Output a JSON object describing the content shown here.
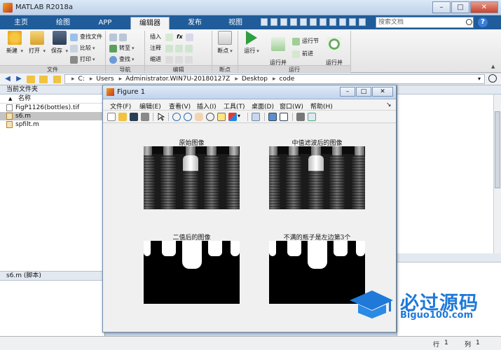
{
  "window": {
    "title": "MATLAB R2018a",
    "minimize": "–",
    "maximize": "□",
    "close": "✕"
  },
  "tabs": [
    {
      "label": "主页"
    },
    {
      "label": "绘图"
    },
    {
      "label": "APP"
    },
    {
      "label": "编辑器"
    },
    {
      "label": "发布"
    },
    {
      "label": "视图"
    }
  ],
  "search": {
    "placeholder": "搜索文档"
  },
  "help": "?",
  "ribbon": {
    "file": {
      "group": "文件",
      "new": "新建",
      "open": "打开",
      "save": "保存",
      "find_files": "查找文件",
      "compare": "比较",
      "print": "打印"
    },
    "navigate": {
      "group": "导航",
      "goto": "转至",
      "find": "查找"
    },
    "edit": {
      "group": "编辑",
      "insert": "插入",
      "comment": "注释",
      "indent": "缩进",
      "fx": "fx"
    },
    "breakpoints": {
      "group": "断点",
      "breakpoint": "断点"
    },
    "run": {
      "group": "运行",
      "run": "运行",
      "run_advance": "运行并\n前进",
      "run_section": "运行节",
      "advance": "前进",
      "run_time": "运行并\n计时"
    }
  },
  "address": {
    "crumbs": [
      "C:",
      "Users",
      "Administrator.WIN7U-20180127Z",
      "Desktop",
      "code"
    ]
  },
  "current_folder": {
    "title": "当前文件夹",
    "column_header": "名称",
    "sort_arrow": "▲",
    "files": [
      {
        "name": "FigP1126(bottles).tif",
        "type": "image",
        "selected": false
      },
      {
        "name": "s6.m",
        "type": "m",
        "selected": true
      },
      {
        "name": "spfilt.m",
        "type": "m",
        "selected": false
      }
    ],
    "details": "s6.m  (脚本)"
  },
  "figure": {
    "title": "Figure 1",
    "menus": [
      "文件(F)",
      "编辑(E)",
      "查看(V)",
      "插入(I)",
      "工具(T)",
      "桌面(D)",
      "窗口(W)",
      "帮助(H)"
    ],
    "dock_arrow": "↘",
    "subplots": [
      {
        "title": "原始图像",
        "kind": "gray"
      },
      {
        "title": "中值滤波后的图像",
        "kind": "gray"
      },
      {
        "title": "二值后的图像",
        "kind": "binary"
      },
      {
        "title": "不满的瓶子是左边第3个",
        "kind": "binary"
      }
    ]
  },
  "status": {
    "row_label": "行",
    "row_value": "1",
    "col_label": "列",
    "col_value": "1"
  },
  "watermark": {
    "text": "必过源码",
    "url": "Biguo100.com"
  },
  "colors": {
    "tab_bar": "#1f5c99",
    "accent": "#1f79d9"
  }
}
